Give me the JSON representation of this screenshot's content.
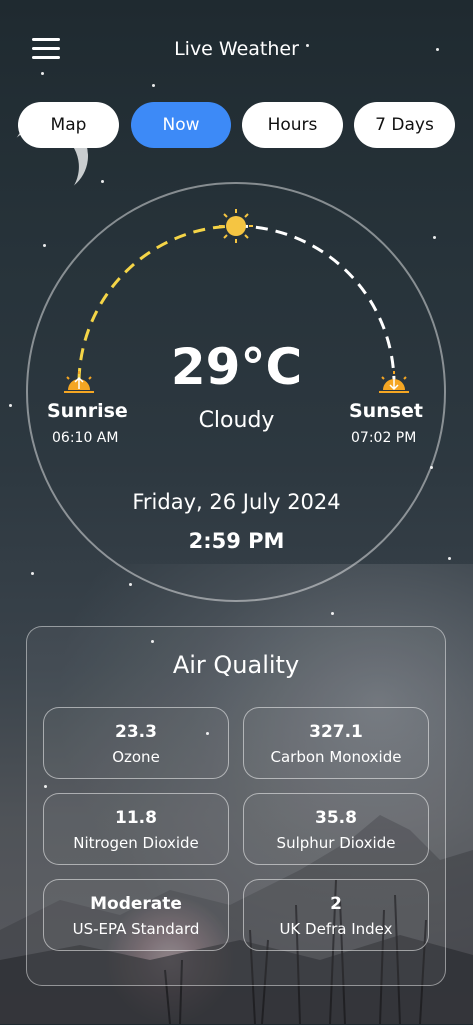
{
  "header": {
    "title": "Live Weather"
  },
  "tabs": [
    {
      "label": "Map"
    },
    {
      "label": "Now"
    },
    {
      "label": "Hours"
    },
    {
      "label": "7 Days"
    }
  ],
  "weather": {
    "temperature": "29°C",
    "condition": "Cloudy",
    "sunrise_label": "Sunrise",
    "sunrise_time": "06:10 AM",
    "sunset_label": "Sunset",
    "sunset_time": "07:02 PM",
    "date": "Friday, 26 July 2024",
    "time": "2:59 PM"
  },
  "air_quality": {
    "title": "Air Quality",
    "items": [
      {
        "value": "23.3",
        "label": "Ozone"
      },
      {
        "value": "327.1",
        "label": "Carbon Monoxide"
      },
      {
        "value": "11.8",
        "label": "Nitrogen Dioxide"
      },
      {
        "value": "35.8",
        "label": "Sulphur Dioxide"
      },
      {
        "value": "Moderate",
        "label": "US-EPA Standard"
      },
      {
        "value": "2",
        "label": "UK Defra Index"
      }
    ]
  },
  "colors": {
    "accent": "#3d8af7",
    "sun": "#f5c542",
    "sunrise_icon": "#f5a623"
  }
}
